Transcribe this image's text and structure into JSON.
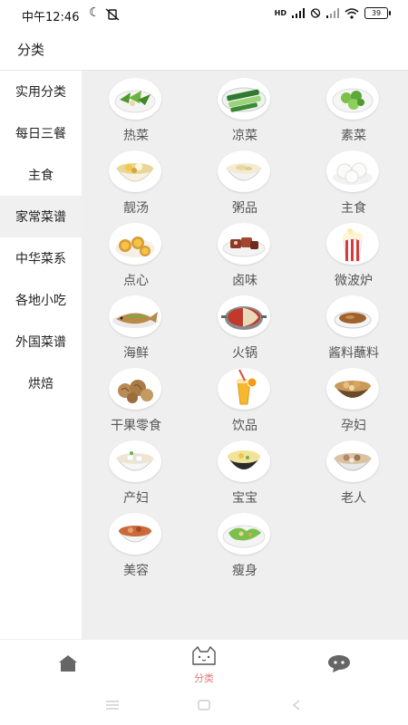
{
  "status": {
    "time": "中午12:46",
    "hd": "HD",
    "battery": "39"
  },
  "header": {
    "title": "分类"
  },
  "sidebar": {
    "items": [
      {
        "label": "实用分类"
      },
      {
        "label": "每日三餐"
      },
      {
        "label": "主食"
      },
      {
        "label": "家常菜谱"
      },
      {
        "label": "中华菜系"
      },
      {
        "label": "各地小吃"
      },
      {
        "label": "外国菜谱"
      },
      {
        "label": "烘焙"
      }
    ],
    "active_index": 3
  },
  "categories": [
    {
      "label": "热菜",
      "icon": "stir-fried-greens"
    },
    {
      "label": "凉菜",
      "icon": "cold-cucumber-dish"
    },
    {
      "label": "素菜",
      "icon": "vegetable-dish"
    },
    {
      "label": "靓汤",
      "icon": "soup-bowl"
    },
    {
      "label": "粥品",
      "icon": "porridge-bowl"
    },
    {
      "label": "主食",
      "icon": "steamed-buns"
    },
    {
      "label": "点心",
      "icon": "egg-tarts"
    },
    {
      "label": "卤味",
      "icon": "braised-meat"
    },
    {
      "label": "微波炉",
      "icon": "popcorn"
    },
    {
      "label": "海鲜",
      "icon": "whole-fish"
    },
    {
      "label": "火锅",
      "icon": "hot-pot"
    },
    {
      "label": "酱料蘸料",
      "icon": "sauce-dish"
    },
    {
      "label": "干果零食",
      "icon": "walnuts"
    },
    {
      "label": "饮品",
      "icon": "orange-drink"
    },
    {
      "label": "孕妇",
      "icon": "stew-pot"
    },
    {
      "label": "产妇",
      "icon": "tofu-soup"
    },
    {
      "label": "宝宝",
      "icon": "egg-custard"
    },
    {
      "label": "老人",
      "icon": "clay-pot-soup"
    },
    {
      "label": "美容",
      "icon": "dessert-soup"
    },
    {
      "label": "瘦身",
      "icon": "salad-plate"
    }
  ],
  "tabbar": {
    "tabs": [
      {
        "label": "",
        "icon": "home-icon"
      },
      {
        "label": "分类",
        "icon": "cat-face-icon",
        "active": true
      },
      {
        "label": "",
        "icon": "chat-bubble-icon"
      }
    ]
  },
  "colors": {
    "active_tab": "#e07a7a",
    "content_bg": "#efefef",
    "sidebar_active_bg": "#f0f0f0"
  }
}
